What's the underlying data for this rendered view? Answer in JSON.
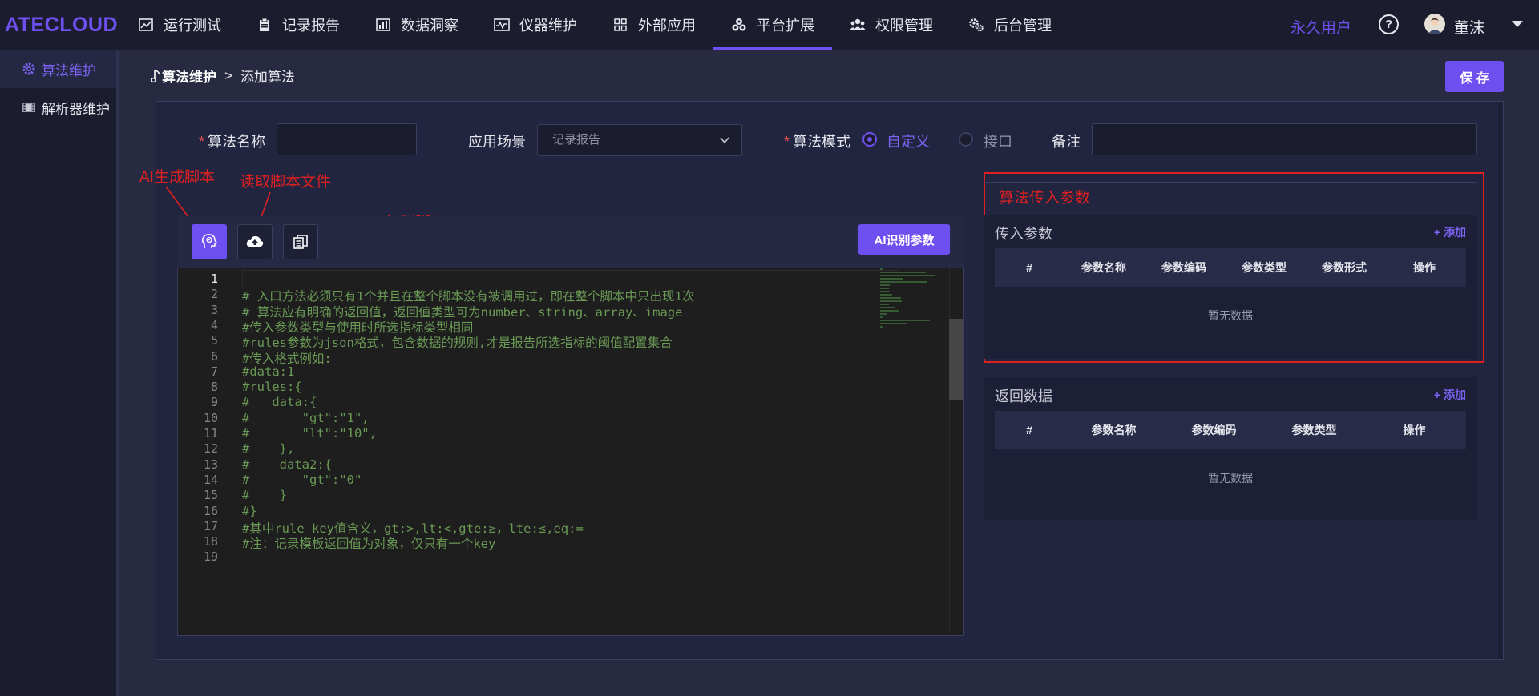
{
  "app": {
    "logo": "ATECLOUD"
  },
  "nav": {
    "items": [
      {
        "label": "运行测试",
        "icon": "line-chart-icon"
      },
      {
        "label": "记录报告",
        "icon": "clipboard-icon"
      },
      {
        "label": "数据洞察",
        "icon": "bar-chart-icon"
      },
      {
        "label": "仪器维护",
        "icon": "instrument-icon"
      },
      {
        "label": "外部应用",
        "icon": "grid-icon"
      },
      {
        "label": "平台扩展",
        "icon": "cluster-icon",
        "active": true
      },
      {
        "label": "权限管理",
        "icon": "users-icon"
      },
      {
        "label": "后台管理",
        "icon": "gears-icon"
      }
    ],
    "user_type": "永久用户",
    "help": "?",
    "username": "董沫"
  },
  "sidebar": {
    "items": [
      {
        "label": "算法维护",
        "icon": "gear-icon",
        "active": true
      },
      {
        "label": "解析器维护",
        "icon": "film-icon"
      }
    ]
  },
  "breadcrumb": {
    "root": "算法维护",
    "separator": ">",
    "current": "添加算法"
  },
  "toolbar": {
    "save_label": "保 存",
    "ai_params_label": "AI识别参数"
  },
  "form": {
    "name_label": "算法名称",
    "name_value": "",
    "scene_label": "应用场景",
    "scene_value": "记录报告",
    "mode_label": "算法模式",
    "mode_options": [
      "自定义",
      "接口"
    ],
    "mode_selected": "自定义",
    "remark_label": "备注",
    "remark_value": ""
  },
  "annotations": {
    "ai_generate": "AI生成脚本",
    "read_file": "读取脚本文件",
    "copy_script": "复制脚本",
    "input_params": "算法传入参数"
  },
  "editor": {
    "lines": [
      "",
      "# 入口方法必须只有1个并且在整个脚本没有被调用过，即在整个脚本中只出现1次",
      "# 算法应有明确的返回值，返回值类型可为number、string、array、image",
      "#传入参数类型与使用时所选指标类型相同",
      "#rules参数为json格式，包含数据的规则,才是报告所选指标的阈值配置集合",
      "#传入格式例如:",
      "#data:1",
      "#rules:{",
      "#   data:{",
      "#       \"gt\":\"1\",",
      "#       \"lt\":\"10\",",
      "#    },",
      "#    data2:{",
      "#       \"gt\":\"0\"",
      "#    }",
      "#}",
      "#其中rule key值含义，gt:>,lt:<,gte:≥，lte:≤,eq:=",
      "#注：记录模板返回值为对象，仅只有一个key",
      ""
    ],
    "current_line": 1
  },
  "input_params": {
    "title": "传入参数",
    "add_label": "+ 添加",
    "columns": [
      "#",
      "参数名称",
      "参数编码",
      "参数类型",
      "参数形式",
      "操作"
    ],
    "empty_text": "暂无数据"
  },
  "return_data": {
    "title": "返回数据",
    "add_label": "+ 添加",
    "columns": [
      "#",
      "参数名称",
      "参数编码",
      "参数类型",
      "操作"
    ],
    "empty_text": "暂无数据"
  },
  "colors": {
    "accent": "#6e4ff0",
    "annotation": "#e02020",
    "code_comment": "#6a9955",
    "background": "#272a40"
  }
}
